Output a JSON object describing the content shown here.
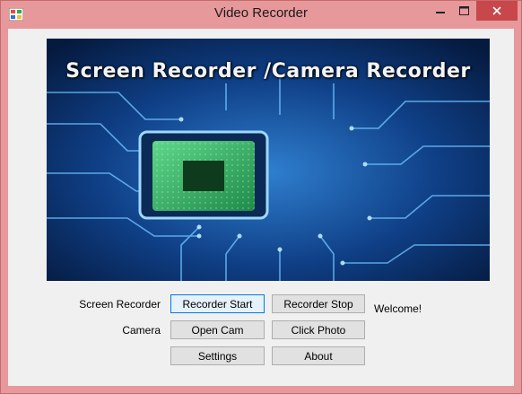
{
  "window": {
    "title": "Video Recorder"
  },
  "banner": {
    "heading": "Screen Recorder /Camera Recorder"
  },
  "labels": {
    "screen_recorder": "Screen Recorder",
    "camera": "Camera",
    "status": "Welcome!"
  },
  "buttons": {
    "recorder_start": "Recorder Start",
    "recorder_stop": "Recorder Stop",
    "open_cam": "Open Cam",
    "click_photo": "Click Photo",
    "settings": "Settings",
    "about": "About"
  },
  "icons": {
    "app": "app-icon",
    "minimize": "minimize-icon",
    "maximize": "maximize-icon",
    "close": "close-icon"
  },
  "colors": {
    "titlebar": "#e7989a",
    "close": "#c7474a",
    "client": "#f0f0f0",
    "focus_border": "#0078d7"
  }
}
